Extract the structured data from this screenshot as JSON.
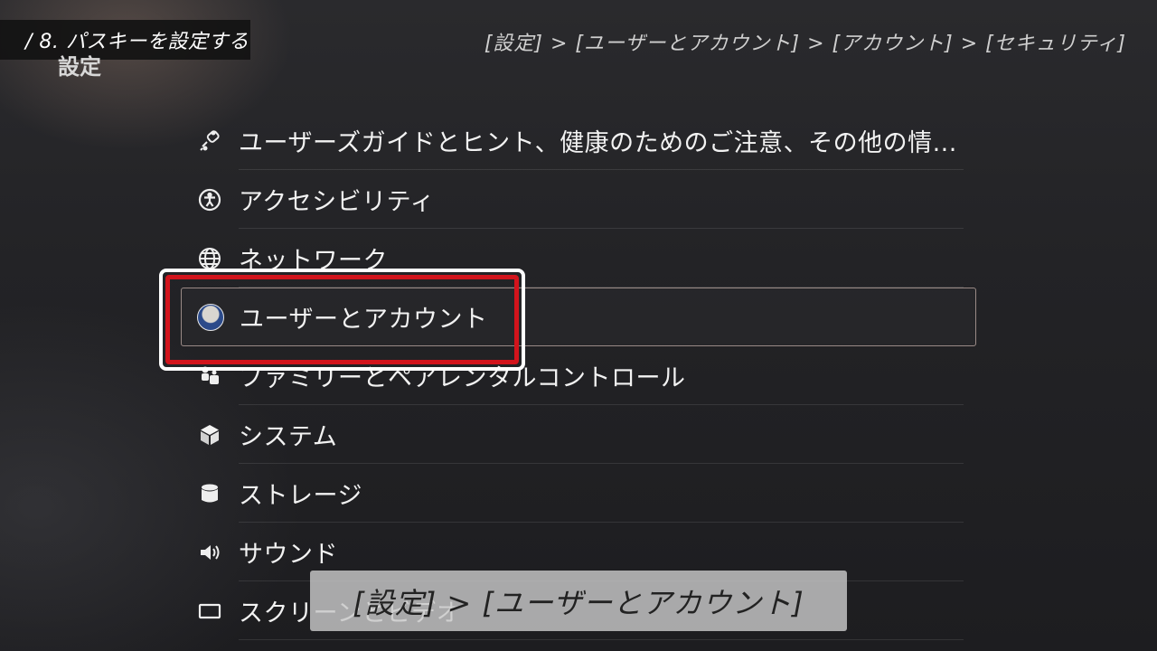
{
  "step_label": "/ 8. パスキーを設定する",
  "page_title": "設定",
  "breadcrumb": "[設定]  >  [ユーザーとアカウント]  >  [アカウント]  >  [セキュリティ]",
  "menu": {
    "items": [
      {
        "label": "ユーザーズガイドとヒント、健康のためのご注意、その他の情...",
        "icon": "controller-tips-icon"
      },
      {
        "label": "アクセシビリティ",
        "icon": "accessibility-icon"
      },
      {
        "label": "ネットワーク",
        "icon": "globe-icon"
      },
      {
        "label": "ユーザーとアカウント",
        "icon": "avatar"
      },
      {
        "label": "ファミリーとペアレンタルコントロール",
        "icon": "family-icon"
      },
      {
        "label": "システム",
        "icon": "cube-icon"
      },
      {
        "label": "ストレージ",
        "icon": "storage-icon"
      },
      {
        "label": "サウンド",
        "icon": "speaker-icon"
      },
      {
        "label": "スクリーンとビデオ",
        "icon": "screen-icon"
      }
    ],
    "selected_index": 3
  },
  "caption": "[設定] > [ユーザーとアカウント]",
  "colors": {
    "highlight_red": "#d2141c",
    "selection_border": "#9a8a86"
  }
}
